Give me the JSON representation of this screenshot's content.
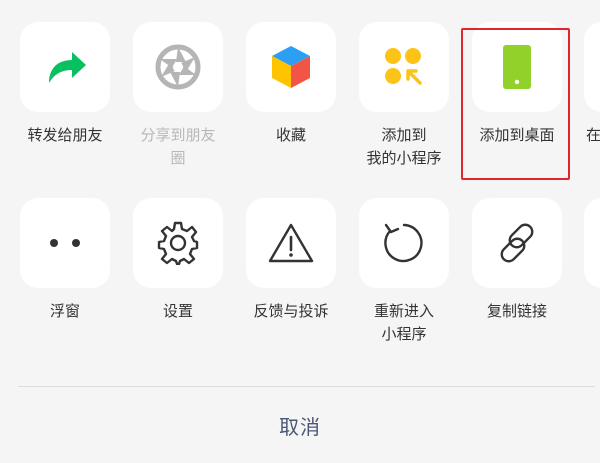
{
  "row1": [
    {
      "label": "转发给朋友",
      "icon": "forward-arrow-icon"
    },
    {
      "label": "分享到朋友\n圈",
      "icon": "moments-aperture-icon"
    },
    {
      "label": "收藏",
      "icon": "favorites-cube-icon"
    },
    {
      "label": "添加到\n我的小程序",
      "icon": "mini-program-add-icon"
    },
    {
      "label": "添加到桌面",
      "icon": "phone-desktop-icon"
    },
    {
      "label": "在",
      "icon": ""
    }
  ],
  "row2": [
    {
      "label": "浮窗",
      "icon": "floating-window-dots-icon"
    },
    {
      "label": "设置",
      "icon": "gear-icon"
    },
    {
      "label": "反馈与投诉",
      "icon": "warning-triangle-icon"
    },
    {
      "label": "重新进入\n小程序",
      "icon": "refresh-icon"
    },
    {
      "label": "复制链接",
      "icon": "link-icon"
    }
  ],
  "cancel_label": "取消",
  "colors": {
    "forward_green": "#07c160",
    "phone_green": "#91d12a",
    "mini_program_yellow": "#fcc419",
    "highlight_red": "#e0252b",
    "cancel_text": "#4a5775"
  }
}
